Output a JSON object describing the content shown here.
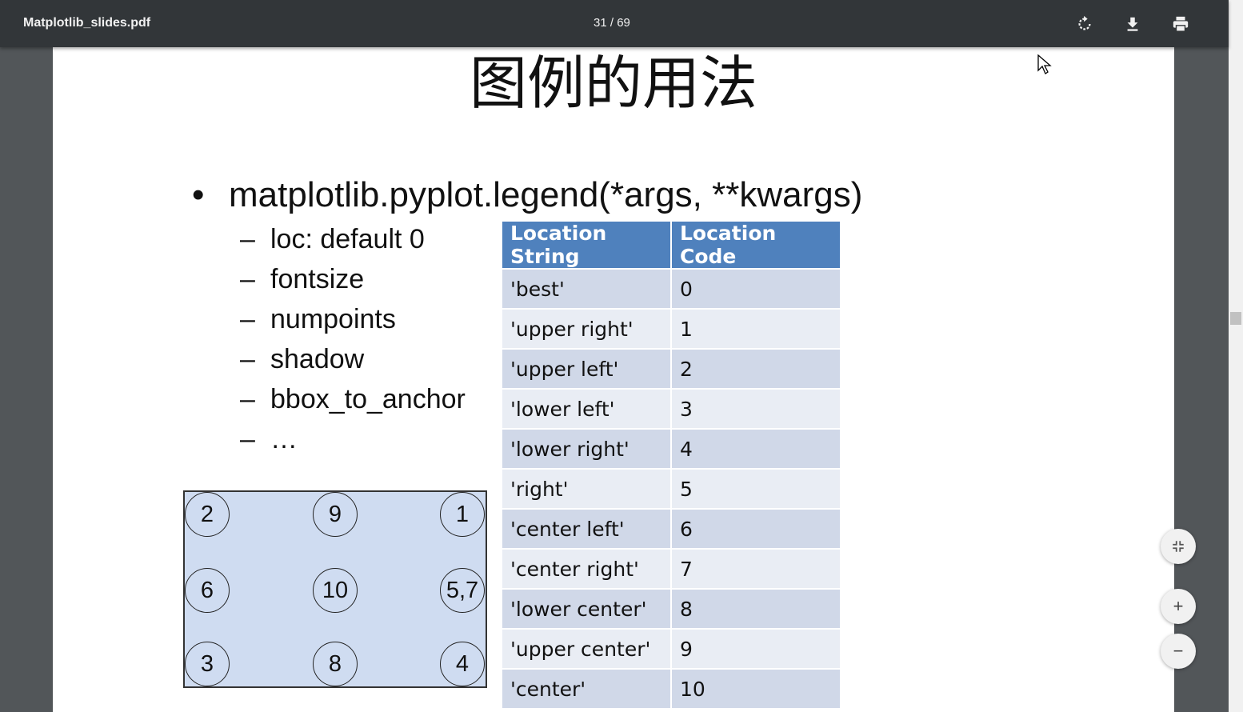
{
  "viewer": {
    "file_name": "Matplotlib_slides.pdf",
    "current_page": "31",
    "page_separator": " / ",
    "total_pages": "69"
  },
  "icons": {
    "rotate": "rotate-icon",
    "download": "download-icon",
    "print": "print-icon",
    "fit": "fit-to-page-icon",
    "zoom_in": "zoom-in-icon",
    "zoom_out": "zoom-out-icon"
  },
  "controls": {
    "zoom_in_label": "+",
    "zoom_out_label": "−"
  },
  "slide": {
    "title": "图例的用法",
    "bullet_marker": "•",
    "bullet_text": "matplotlib.pyplot.legend(*args, **kwargs)",
    "dash": "–",
    "sub_items": [
      "loc: default 0",
      "fontsize",
      "numpoints",
      "shadow",
      "bbox_to_anchor",
      "…"
    ],
    "table": {
      "headers": [
        "Location String",
        "Location Code"
      ],
      "rows": [
        [
          "'best'",
          "0"
        ],
        [
          "'upper right'",
          "1"
        ],
        [
          "'upper left'",
          "2"
        ],
        [
          "'lower left'",
          "3"
        ],
        [
          "'lower right'",
          "4"
        ],
        [
          "'right'",
          "5"
        ],
        [
          "'center left'",
          "6"
        ],
        [
          "'center right'",
          "7"
        ],
        [
          "'lower center'",
          "8"
        ],
        [
          "'upper center'",
          "9"
        ],
        [
          "'center'",
          "10"
        ]
      ]
    },
    "diagram_labels": {
      "top_left": "2",
      "top_center": "9",
      "top_right": "1",
      "middle_left": "6",
      "middle_center": "10",
      "middle_right": "5,7",
      "bottom_left": "3",
      "bottom_center": "8",
      "bottom_right": "4"
    },
    "colors": {
      "table_header": "#4f81bd",
      "table_row_odd": "#d0d8e8",
      "table_row_even": "#e9edf4",
      "diagram_fill": "#cfdcf1",
      "toolbar": "#323639"
    }
  }
}
